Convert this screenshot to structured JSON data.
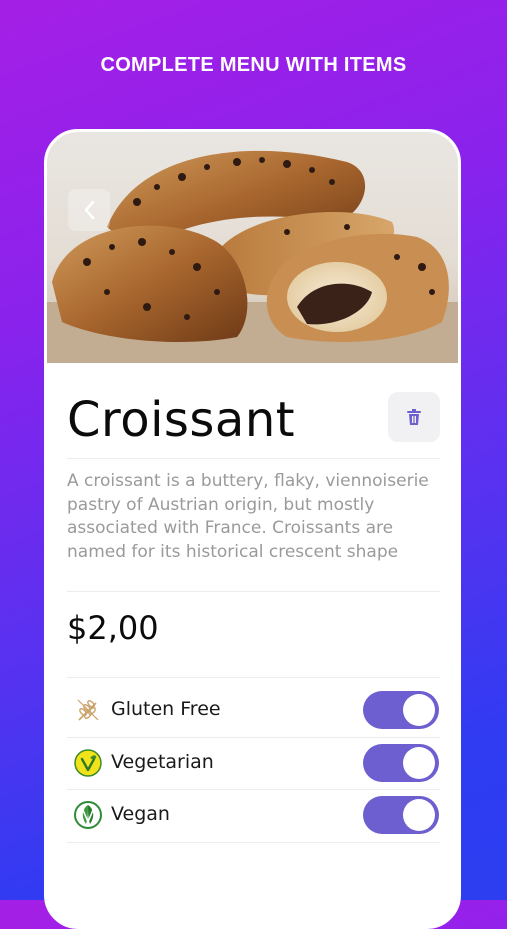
{
  "banner": {
    "text": "COMPLETE MENU WITH ITEMS"
  },
  "colors": {
    "accent": "#6d5fd0",
    "gradient_top": "#a51fe6",
    "gradient_bottom": "#2c3ef0"
  },
  "item": {
    "name": "Croissant",
    "description": "A croissant is a buttery, flaky, viennoiserie pastry of Austrian origin, but mostly associated with France. Croissants are named for its historical crescent shape",
    "price": "$2,00"
  },
  "options": [
    {
      "label": "Gluten Free",
      "icon": "wheat-icon",
      "enabled": true
    },
    {
      "label": "Vegetarian",
      "icon": "vegetarian-icon",
      "enabled": true
    },
    {
      "label": "Vegan",
      "icon": "vegan-icon",
      "enabled": true
    }
  ],
  "icons": {
    "back": "chevron-left-icon",
    "delete": "trash-icon"
  }
}
